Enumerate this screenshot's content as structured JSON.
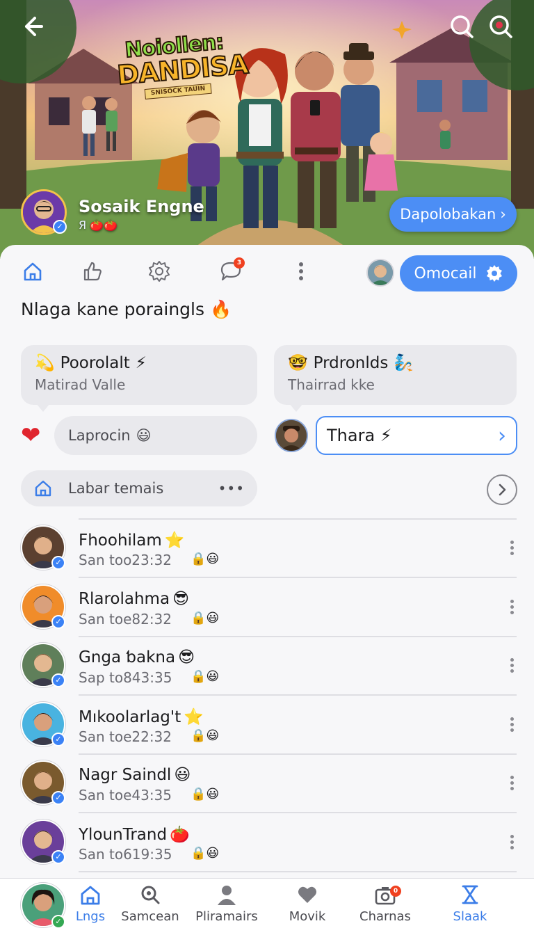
{
  "hero": {
    "logo_line1": "Noiollen:",
    "logo_line2": "DANDISA",
    "logo_tagline": "SNISOCK TAUIN",
    "channel_name": "Sosaik Engne",
    "channel_sub": "Я 🍅🍅",
    "download_label": "Dapolobakan",
    "download_chevron": "›"
  },
  "icons": {
    "back": "back-arrow-icon",
    "search_hero": "search-icon",
    "search_hero_alt": "search-alt-icon"
  },
  "toolbar": {
    "badge_count": "3",
    "pill_label": "Omocail"
  },
  "section": {
    "title": "Nlaga kane poraingls",
    "title_emoji": "🔥"
  },
  "cards": [
    {
      "emoji": "💫",
      "title": "Poorolalt",
      "title_emoji": "⚡",
      "subtitle": "Matirad Valle"
    },
    {
      "emoji": "🤓",
      "title": "Prdronlds",
      "title_emoji": "🧞",
      "subtitle": "Thairrad kke"
    }
  ],
  "reactions": {
    "heart": "❤",
    "pill_text": "Laprocin",
    "pill_emoji": "😃",
    "reply_value": "Thara",
    "reply_emoji": "⚡",
    "reply_chevron": "›"
  },
  "filter": {
    "label": "Labar temais",
    "more": "•••"
  },
  "list": [
    {
      "name": "Fhoohilam",
      "tag": "⭐",
      "time": "San too23:32",
      "mini": "🔒😃",
      "avatar_bg": "#5b4030",
      "avatar_skin": "#e0b08a",
      "avatar_hair": "#3a2a1c"
    },
    {
      "name": "Rlarolahma",
      "tag": "😎",
      "time": "San toe82:32",
      "mini": "🔒😃",
      "avatar_bg": "#f08c2a",
      "avatar_skin": "#d9a07c",
      "avatar_hair": "#1e1410"
    },
    {
      "name": "Gnga ƅakna",
      "tag": "😎",
      "time": "Sap to843:35",
      "mini": "🔒😃",
      "avatar_bg": "#5f7f5a",
      "avatar_skin": "#e3b891",
      "avatar_hair": "#6b4a2a"
    },
    {
      "name": "Mıkoolarlag't",
      "tag": "⭐",
      "time": "San toe22:32",
      "mini": "🔒😃",
      "avatar_bg": "#49b3e0",
      "avatar_skin": "#d9a07c",
      "avatar_hair": "#1e1410"
    },
    {
      "name": "Nagr Saindl",
      "tag": "😃",
      "time": "San toe43:35",
      "mini": "🔒😃",
      "avatar_bg": "#7a5a2e",
      "avatar_skin": "#e0b08a",
      "avatar_hair": "#5a3a1c"
    },
    {
      "name": "YlounTrand",
      "tag": "🍅",
      "time": "San to619:35",
      "mini": "🔒😃",
      "avatar_bg": "#6a3f9a",
      "avatar_skin": "#e3b891",
      "avatar_hair": "#20150e"
    }
  ],
  "bottom_nav": [
    {
      "label": "Lngs",
      "icon": "home-icon",
      "active": true
    },
    {
      "label": "Samcean",
      "icon": "search-icon",
      "active": false
    },
    {
      "label": "Pliramairs",
      "icon": "person-icon",
      "active": false
    },
    {
      "label": "Movik",
      "icon": "heart-icon",
      "active": false
    },
    {
      "label": "Charnas",
      "icon": "camera-icon",
      "active": false,
      "badge": "0"
    },
    {
      "label": "Slaak",
      "icon": "hourglass-icon",
      "active": false
    }
  ],
  "colors": {
    "accent": "#4c8ef5",
    "badge": "#f0401f",
    "verified": "#3b82f6",
    "heart": "#e0252e"
  }
}
